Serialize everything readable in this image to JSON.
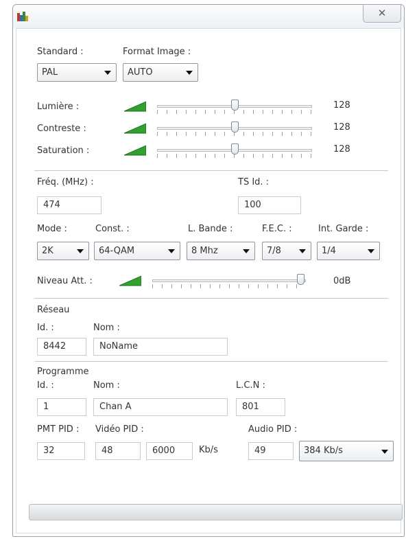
{
  "window": {
    "close_glyph": "✕"
  },
  "image": {
    "standard_label": "Standard :",
    "standard_value": "PAL",
    "format_label": "Format Image :",
    "format_value": "AUTO",
    "lumiere_label": "Lumière :",
    "lumiere_value": "128",
    "contraste_label": "Contreste :",
    "contraste_value": "128",
    "saturation_label": "Saturation :",
    "saturation_value": "128"
  },
  "tuning": {
    "freq_label": "Fréq. (MHz) :",
    "freq_value": "474",
    "tsid_label": "TS Id. :",
    "tsid_value": "100",
    "mode_label": "Mode :",
    "mode_value": "2K",
    "const_label": "Const. :",
    "const_value": "64-QAM",
    "bande_label": "L. Bande :",
    "bande_value": "8 Mhz",
    "fec_label": "F.E.C. :",
    "fec_value": "7/8",
    "garde_label": "Int. Garde :",
    "garde_value": "1/4",
    "niveau_label": "Niveau Att. :",
    "niveau_value": "0dB"
  },
  "reseau": {
    "section_label": "Réseau",
    "id_label": "Id. :",
    "id_value": "8442",
    "nom_label": "Nom :",
    "nom_value": "NoName"
  },
  "programme": {
    "section_label": "Programme",
    "id_label": "Id. :",
    "id_value": "1",
    "nom_label": "Nom :",
    "nom_value": "Chan A",
    "lcn_label": "L.C.N :",
    "lcn_value": "801",
    "pmt_label": "PMT PID :",
    "pmt_value": "32",
    "video_label": "Vidéo PID :",
    "video_pid_value": "48",
    "video_rate_value": "6000",
    "video_unit": "Kb/s",
    "audio_label": "Audio PID :",
    "audio_pid_value": "49",
    "audio_rate_value": "384 Kb/s"
  },
  "sliders": {
    "lumiere_level": 0.5,
    "contraste_level": 0.5,
    "saturation_level": 0.5,
    "niveau_level": 1.0
  },
  "colors": {
    "volume_icon": "#2fa12f"
  },
  "icons": [
    "app-icon",
    "close-icon",
    "volume-icon",
    "chevron-down-icon"
  ]
}
